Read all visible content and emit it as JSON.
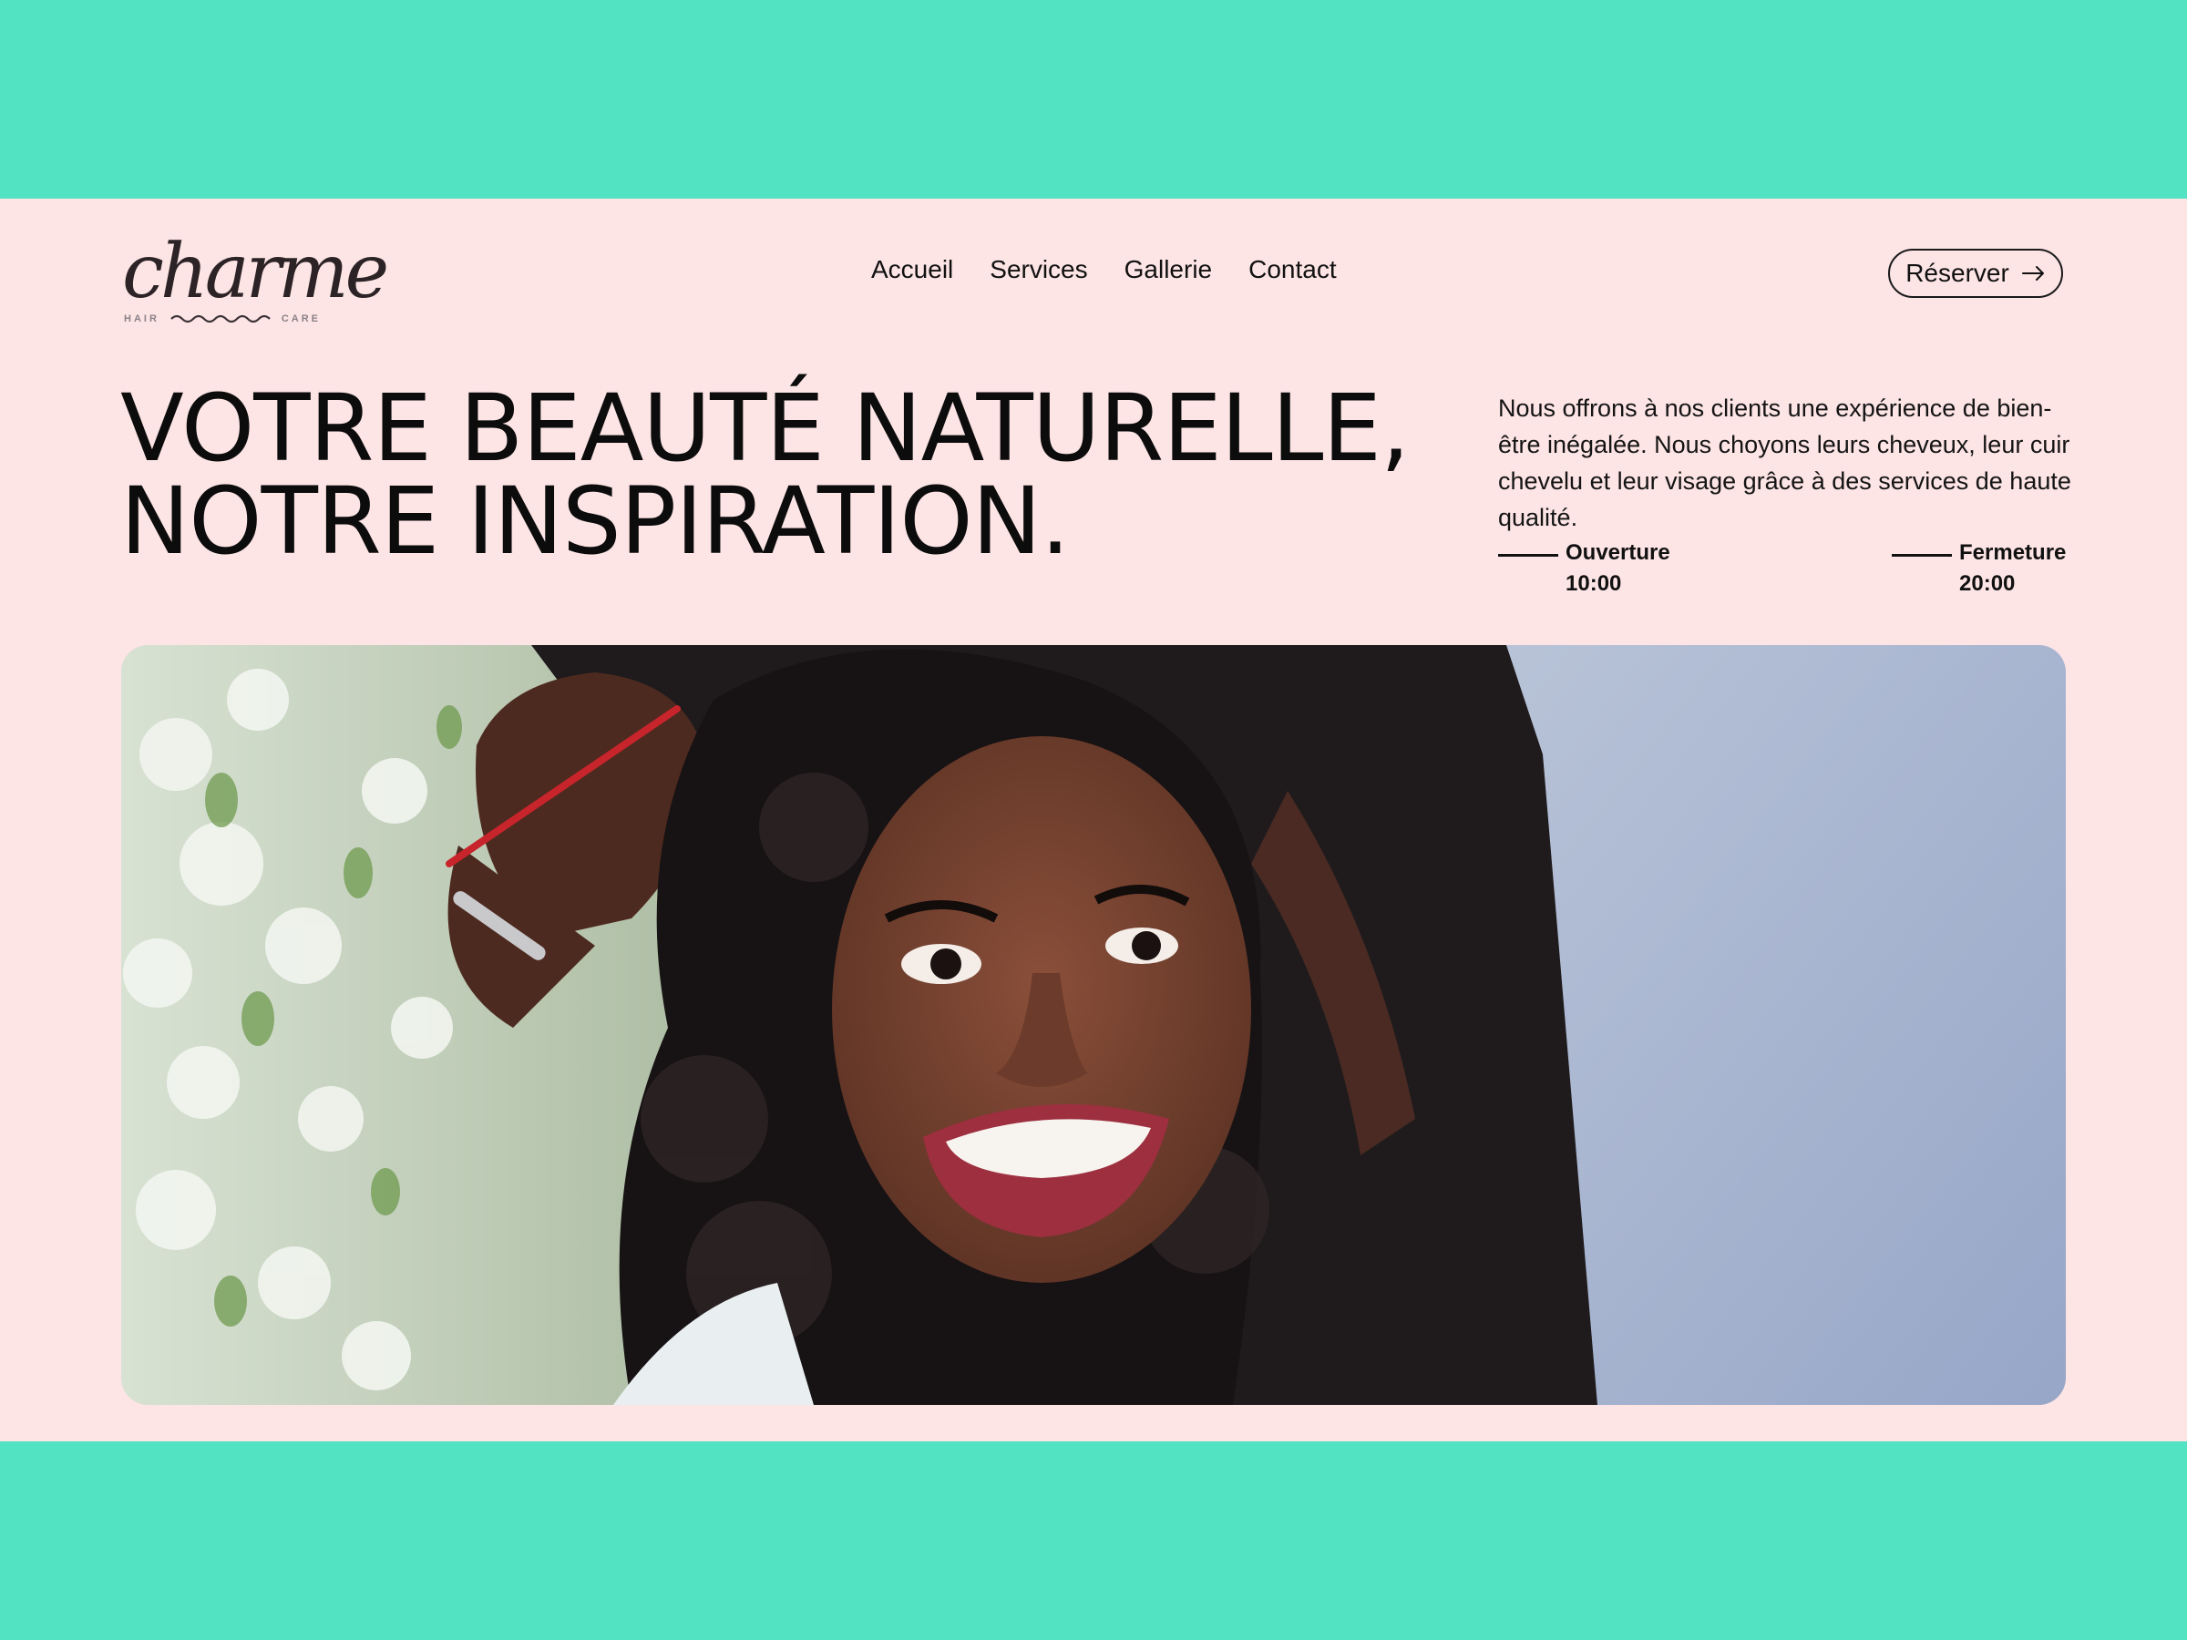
{
  "brand": {
    "logo_word": "charme",
    "logo_left": "HAIR",
    "logo_right": "CARE"
  },
  "nav": {
    "items": [
      {
        "label": "Accueil"
      },
      {
        "label": "Services"
      },
      {
        "label": "Gallerie"
      },
      {
        "label": "Contact"
      }
    ]
  },
  "header": {
    "cta_label": "Réserver",
    "cta_icon": "arrow-right-icon"
  },
  "hero": {
    "headline_line1": "VOTRE BEAUTÉ NATURELLE,",
    "headline_line2": "NOTRE INSPIRATION.",
    "intro": "Nous offrons à nos clients une expérience de bien-être inégalée. Nous choyons leurs cheveux, leur cuir chevelu et leur visage grâce à des services de haute qualité.",
    "opening": {
      "label": "Ouverture",
      "time": "10:00"
    },
    "closing": {
      "label": "Fermeture",
      "time": "20:00"
    }
  },
  "colors": {
    "outer_background": "#52e3c2",
    "page_background": "#fde4e5",
    "text": "#111111"
  }
}
